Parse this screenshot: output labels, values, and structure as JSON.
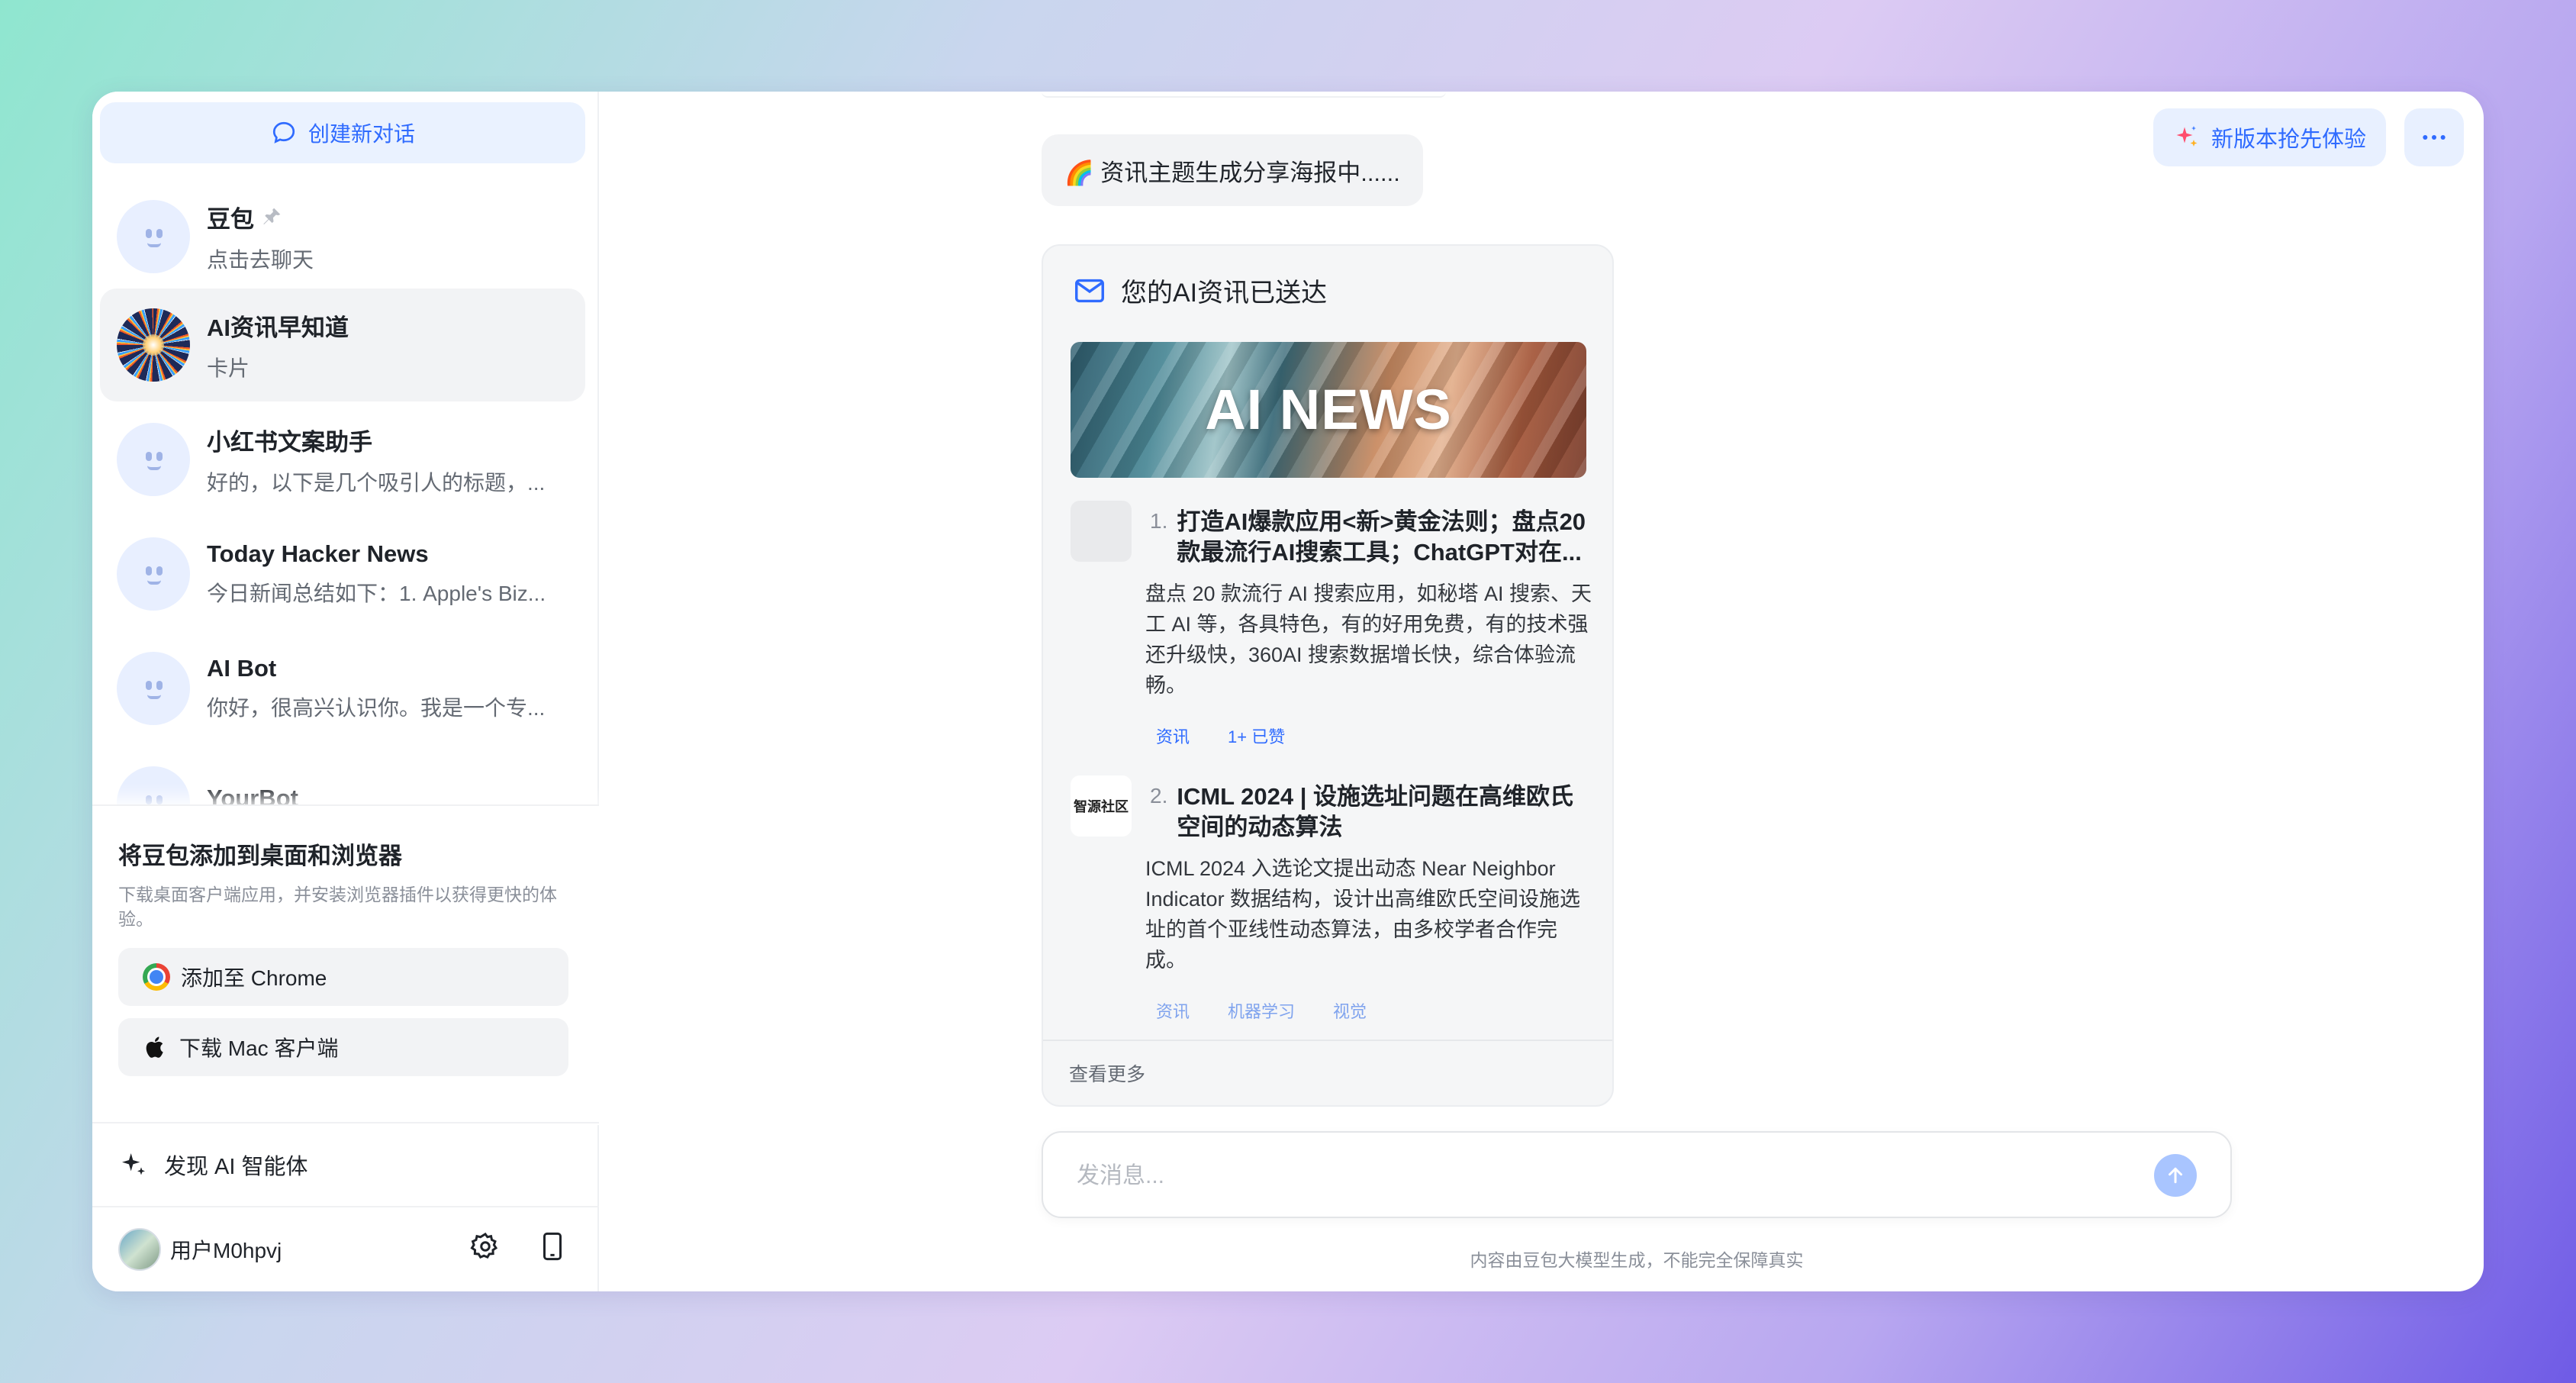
{
  "sidebar": {
    "new_chat_label": "创建新对话",
    "chats": [
      {
        "title": "豆包",
        "subtitle": "点击去聊天",
        "pinned": true
      },
      {
        "title": "AI资讯早知道",
        "subtitle": "卡片",
        "active": true
      },
      {
        "title": "小红书文案助手",
        "subtitle": "好的，以下是几个吸引人的标题，..."
      },
      {
        "title": "Today Hacker News",
        "subtitle": "今日新闻总结如下：1. Apple's Biz..."
      },
      {
        "title": "AI Bot",
        "subtitle": "你好，很高兴认识你。我是一个专..."
      },
      {
        "title": "YourBot",
        "subtitle": ""
      }
    ],
    "promo": {
      "title": "将豆包添加到桌面和浏览器",
      "description": "下载桌面客户端应用，并安装浏览器插件以获得更快的体验。",
      "chrome_label": "添加至 Chrome",
      "mac_label": "下载 Mac 客户端"
    },
    "discover_label": "发现 AI 智能体",
    "user_name": "用户M0hpvj"
  },
  "header": {
    "try_new_label": "新版本抢先体验"
  },
  "conversation": {
    "status_message": "🌈 资讯主题生成分享海报中......",
    "card": {
      "title": "您的AI资讯已送达",
      "banner_text": "AI NEWS",
      "items": [
        {
          "number": "1.",
          "title": "打造AI爆款应用<新>黄金法则；盘点20款最流行AI搜索工具；ChatGPT对在...",
          "body": "盘点 20 款流行 AI 搜索应用，如秘塔 AI 搜索、天工 AI 等，各具特色，有的好用免费，有的技术强还升级快，360AI 搜索数据增长快，综合体验流畅。",
          "tags": [
            "资讯",
            "1+ 已赞"
          ]
        },
        {
          "number": "2.",
          "thumb_label": "智源社区",
          "title": "ICML 2024 | 设施选址问题在高维欧氏空间的动态算法",
          "body": "ICML 2024 入选论文提出动态 Near Neighbor Indicator 数据结构，设计出高维欧氏空间设施选址的首个亚线性动态算法，由多校学者合作完成。",
          "tags": [
            "资讯",
            "机器学习",
            "视觉"
          ]
        }
      ],
      "more_label": "查看更多"
    },
    "input_placeholder": "发消息...",
    "disclaimer": "内容由豆包大模型生成，不能完全保障真实"
  },
  "colors": {
    "accent": "#2f6bff",
    "accent_soft": "#e8f0ff"
  }
}
